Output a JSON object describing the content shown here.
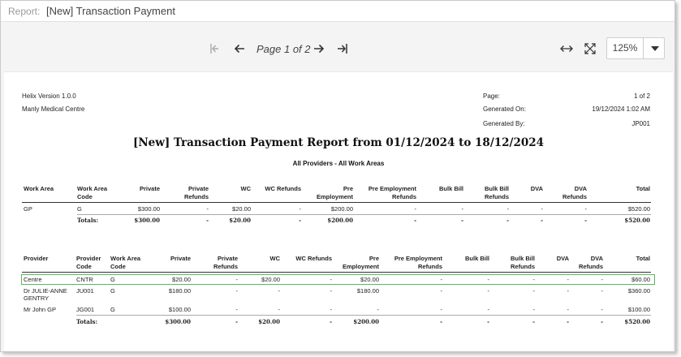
{
  "header": {
    "report_label": "Report:",
    "report_name": "[New] Transaction Payment"
  },
  "toolbar": {
    "page_indicator": "Page 1 of 2",
    "zoom_value": "125%",
    "icons": [
      "first-page-icon",
      "prev-page-icon",
      "next-page-icon",
      "last-page-icon",
      "fit-width-icon",
      "fullscreen-icon",
      "chevron-down-icon"
    ]
  },
  "doc": {
    "version": "Helix Version 1.0.0",
    "centre": "Manly Medical Centre",
    "page_label": "Page:",
    "page_value": "1 of 2",
    "generated_on_label": "Generated On:",
    "generated_on_value": "19/12/2024 1:02 AM",
    "generated_by_label": "Generated By:",
    "generated_by_value": "JP001",
    "title": "[New] Transaction Payment Report from 01/12/2024 to 18/12/2024",
    "subtitle": "All Providers  - All Work Areas"
  },
  "table1": {
    "headers": [
      [
        "Work Area",
        ""
      ],
      [
        "Work Area",
        "Code"
      ],
      [
        "Private",
        ""
      ],
      [
        "Private",
        "Refunds"
      ],
      [
        "WC",
        ""
      ],
      [
        "WC Refunds",
        ""
      ],
      [
        "Pre",
        "Employment"
      ],
      [
        "Pre Employment",
        "Refunds"
      ],
      [
        "Bulk Bill",
        ""
      ],
      [
        "Bulk Bill",
        "Refunds"
      ],
      [
        "DVA",
        ""
      ],
      [
        "DVA",
        "Refunds"
      ],
      [
        "Total",
        ""
      ]
    ],
    "row": [
      "GP",
      "G",
      "$300.00",
      "-",
      "$20.00",
      "-",
      "$200.00",
      "-",
      "-",
      "-",
      "-",
      "-",
      "$520.00"
    ],
    "totals": [
      "",
      "Totals:",
      "$300.00",
      "-",
      "$20.00",
      "-",
      "$200.00",
      "-",
      "-",
      "-",
      "-",
      "-",
      "$520.00"
    ]
  },
  "table2": {
    "headers": [
      [
        "Provider",
        ""
      ],
      [
        "Provider",
        "Code"
      ],
      [
        "Work Area",
        "Code"
      ],
      [
        "Private",
        ""
      ],
      [
        "Private",
        "Refunds"
      ],
      [
        "WC",
        ""
      ],
      [
        "WC Refunds",
        ""
      ],
      [
        "Pre",
        "Employment"
      ],
      [
        "Pre Employment",
        "Refunds"
      ],
      [
        "Bulk Bill",
        ""
      ],
      [
        "Bulk Bill",
        "Refunds"
      ],
      [
        "DVA",
        ""
      ],
      [
        "DVA",
        "Refunds"
      ],
      [
        "Total",
        ""
      ]
    ],
    "rows": [
      [
        "Centre",
        "CNTR",
        "G",
        "$20.00",
        "-",
        "$20.00",
        "-",
        "$20.00",
        "-",
        "-",
        "-",
        "-",
        "-",
        "$60.00"
      ],
      [
        "Dr JULIE-ANNE",
        "JU001",
        "G",
        "$180.00",
        "-",
        "-",
        "-",
        "$180.00",
        "-",
        "-",
        "-",
        "-",
        "-",
        "$360.00"
      ],
      [
        "Mr John GP",
        "JG001",
        "G",
        "$100.00",
        "-",
        "-",
        "-",
        "-",
        "-",
        "-",
        "-",
        "-",
        "-",
        "$100.00"
      ]
    ],
    "row1_line2": "GENTRY",
    "totals": [
      "",
      "Totals:",
      "",
      "$300.00",
      "-",
      "$20.00",
      "-",
      "$200.00",
      "-",
      "-",
      "-",
      "-",
      "-",
      "$520.00"
    ]
  }
}
